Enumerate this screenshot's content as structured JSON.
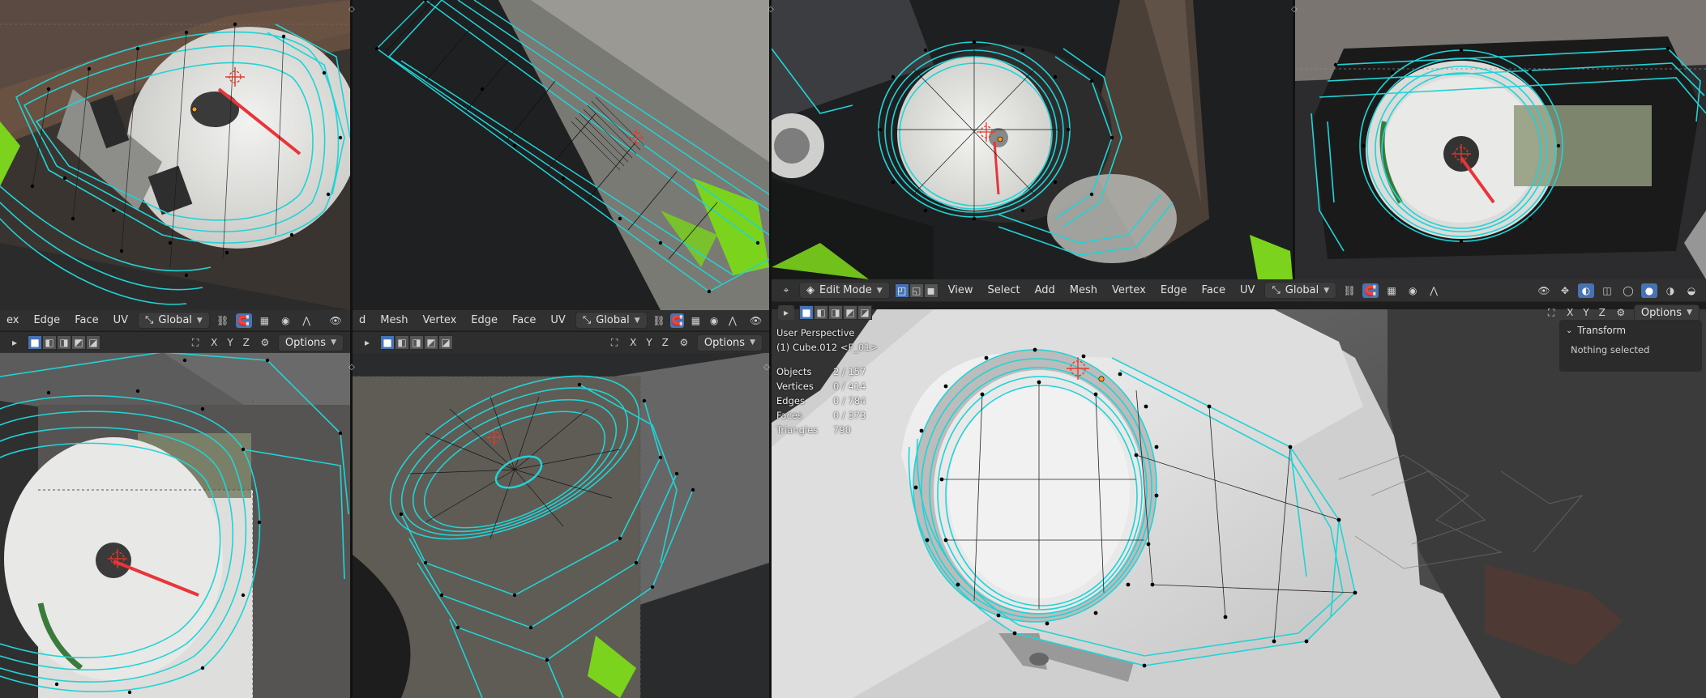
{
  "header_menus": {
    "left_edge": "ex",
    "edge": "Edge",
    "face": "Face",
    "uv": "UV",
    "mid_left_edge": "d",
    "mesh": "Mesh",
    "vertex": "Vertex",
    "view": "View",
    "select": "Select",
    "add": "Add"
  },
  "mode_dropdown": "Edit Mode",
  "orientation": "Global",
  "axes": [
    "X",
    "Y",
    "Z"
  ],
  "options_label": "Options",
  "viewport_info": {
    "view_name": "User Perspective",
    "object_name": "(1) Cube.012 <F_01>"
  },
  "stats": [
    {
      "label": "Objects",
      "value": "2 / 157"
    },
    {
      "label": "Vertices",
      "value": "0 / 414"
    },
    {
      "label": "Edges",
      "value": "0 / 784"
    },
    {
      "label": "Faces",
      "value": "0 / 373"
    },
    {
      "label": "Triangles",
      "value": "790"
    }
  ],
  "n_panel": {
    "title": "Transform",
    "message": "Nothing selected"
  },
  "colors": {
    "wire": "#22d3d6",
    "vertex": "#000000",
    "header_bg": "#303030",
    "accent_blue": "#4772b3",
    "needle": "#e8353a",
    "green_trim": "#7bd31d"
  },
  "icons": {
    "cursor": "3d-cursor-icon",
    "origin": "object-origin-icon"
  }
}
